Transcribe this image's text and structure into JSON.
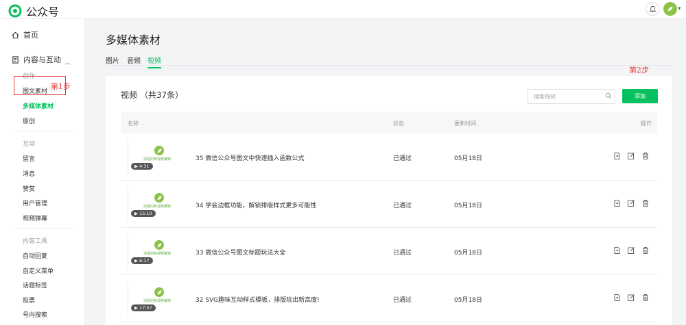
{
  "app": {
    "title": "公众号"
  },
  "sidebar": {
    "home": "首页",
    "content_section": "内容与互动",
    "categories": {
      "create": "创作",
      "interact": "互动",
      "tools": "内容工具"
    },
    "create_items": [
      "图文素材",
      "多媒体素材",
      "原创"
    ],
    "interact_items": [
      "留言",
      "消息",
      "赞赏",
      "用户管理",
      "视频弹幕"
    ],
    "tool_items": [
      "自动回复",
      "自定义菜单",
      "话题标签",
      "投票",
      "号内搜索"
    ]
  },
  "annotations": {
    "step1": "第1步",
    "step2": "第2步"
  },
  "page": {
    "title": "多媒体素材"
  },
  "tabs": [
    "图片",
    "音频",
    "视频"
  ],
  "card": {
    "title": "视频 （共37条）",
    "search_placeholder": "搜索视频",
    "add_label": "添加"
  },
  "table": {
    "headers": [
      "名称",
      "状态",
      "更新时间",
      "操作"
    ]
  },
  "thumbnail_brand": "清姐的和视频编辑",
  "rows": [
    {
      "title": "35 微信公众号图文中快速插入函数公式",
      "duration": "4:31",
      "status": "已通过",
      "date": "05月18日"
    },
    {
      "title": "34 学会边框功能，解锁排版样式更多可能性",
      "duration": "15:10",
      "status": "已通过",
      "date": "05月18日"
    },
    {
      "title": "33 微信公众号图文标题玩法大全",
      "duration": "6:17",
      "status": "已通过",
      "date": "05月18日"
    },
    {
      "title": "32 SVG趣味互动样式模板，排版玩出新高度!",
      "duration": "17:57",
      "status": "已通过",
      "date": "05月18日"
    }
  ],
  "colors": {
    "accent": "#07c160",
    "annotation": "#e23a3a"
  }
}
